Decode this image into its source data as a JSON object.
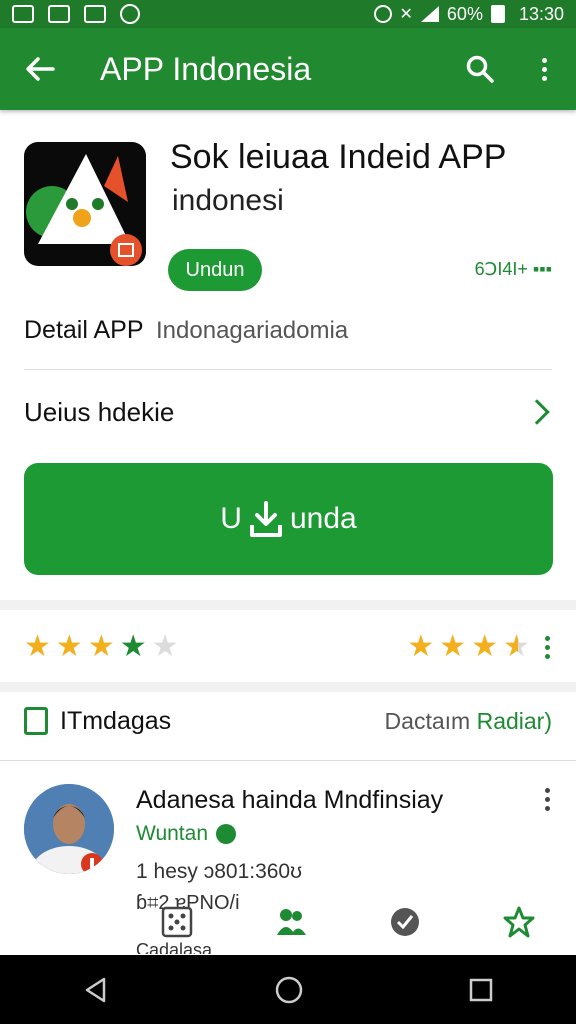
{
  "status_bar": {
    "battery": "60%",
    "time": "13:30"
  },
  "app_bar": {
    "title": "APP Indonesia"
  },
  "app": {
    "name": "Sok leiuaa Indeid APP",
    "developer": "indonesi",
    "install_pill": "Undun",
    "count": "6ↃI4I+ ▪▪▪"
  },
  "detail": {
    "label": "Detail APP",
    "value": "Indonagariadomia"
  },
  "link_row": {
    "label": "Ueius hdekie"
  },
  "big_button": {
    "label_left": "U",
    "label_right": "unda"
  },
  "rating": {
    "left_stars": 4,
    "right_stars": 3.5
  },
  "section": {
    "label": "ITmdagas",
    "right_gray": "Dactaım",
    "right_green": "Radiar)"
  },
  "review": {
    "name": "Adanesa haindа Mndfinsiay",
    "status": "Wuntan",
    "meta": "1 hesy ↄ801:360ʊ",
    "under": "ɓ⌗2 ɐPNO/i",
    "cut": "Cadalasa"
  },
  "colors": {
    "primary": "#21892f",
    "dark": "#1f7a2a",
    "accent": "#1e9a35",
    "star_gold": "#f2b01e",
    "star_green": "#1e8a33"
  },
  "icons": [
    "back-arrow-icon",
    "search-icon",
    "more-vert-icon",
    "download-icon",
    "bookmark-icon",
    "chevron-right-icon",
    "info-icon"
  ]
}
